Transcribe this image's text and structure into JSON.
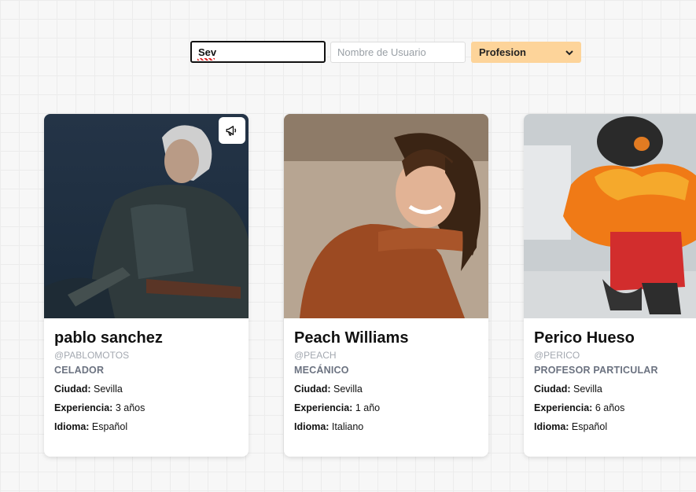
{
  "filters": {
    "name_value": "Sev",
    "username_placeholder": "Nombre de Usuario",
    "profession_selected": "Profesion"
  },
  "cards": [
    {
      "name": "pablo sanchez",
      "handle": "@PABLOMOTOS",
      "profession": "CELADOR",
      "city_label": "Ciudad:",
      "city": " Sevilla",
      "exp_label": "Experiencia:",
      "exp": " 3 años",
      "lang_label": "Idioma:",
      "lang": " Español"
    },
    {
      "name": "Peach Williams",
      "handle": "@PEACH",
      "profession": "MECÁNICO",
      "city_label": "Ciudad:",
      "city": " Sevilla",
      "exp_label": "Experiencia:",
      "exp": " 1 año",
      "lang_label": "Idioma:",
      "lang": " Italiano"
    },
    {
      "name": "Perico Hueso",
      "handle": "@PERICO",
      "profession": "PROFESOR PARTICULAR",
      "city_label": "Ciudad:",
      "city": " Sevilla",
      "exp_label": "Experiencia:",
      "exp": " 6 años",
      "lang_label": "Idioma:",
      "lang": " Español"
    }
  ],
  "icons": {
    "announce": "megaphone-icon",
    "dropdown": "chevron-down-icon"
  }
}
